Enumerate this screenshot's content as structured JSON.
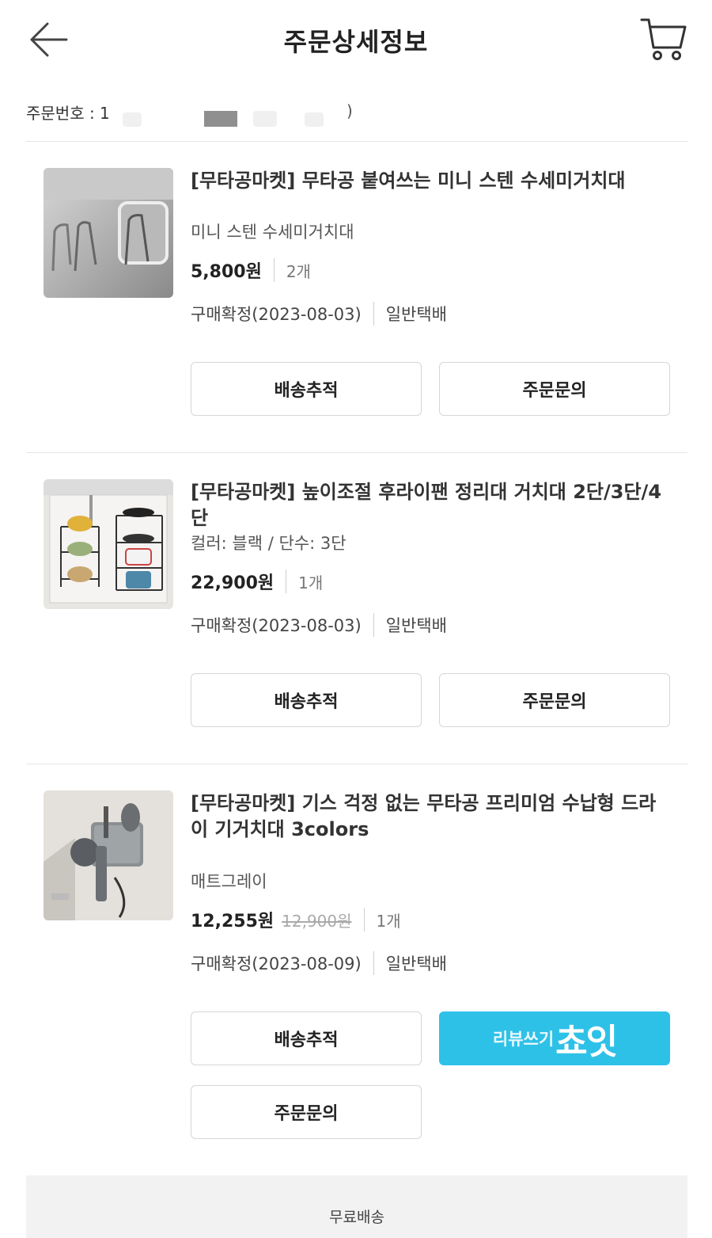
{
  "header": {
    "title": "주문상세정보",
    "back_icon": "arrow-left-icon",
    "cart_icon": "cart-icon"
  },
  "order": {
    "number_label": "주문번호 : 1",
    "trailing": ")"
  },
  "products": [
    {
      "title": "[무타공마켓] 무타공 붙여쓰는 미니 스텐 수세미거치대",
      "option": "미니 스텐 수세미거치대",
      "price": "5,800원",
      "quantity": "2개",
      "status": "구매확정(2023-08-03)",
      "delivery": "일반택배",
      "buttons": {
        "track": "배송추적",
        "inquiry": "주문문의"
      }
    },
    {
      "title": "[무타공마켓] 높이조절 후라이팬 정리대 거치대 2단/3단/4단",
      "option": "컬러: 블랙 / 단수: 3단",
      "price": "22,900원",
      "quantity": "1개",
      "status": "구매확정(2023-08-03)",
      "delivery": "일반택배",
      "buttons": {
        "track": "배송추적",
        "inquiry": "주문문의"
      }
    },
    {
      "title": "[무타공마켓] 기스 걱정 없는 무타공 프리미엄 수납형 드라이 기거치대 3colors",
      "option": "매트그레이",
      "price": "12,255원",
      "original_price": "12,900원",
      "quantity": "1개",
      "status": "구매확정(2023-08-09)",
      "delivery": "일반택배",
      "buttons": {
        "track": "배송추적",
        "review": "리뷰쓰기",
        "review_logo": "쵸잇",
        "inquiry": "주문문의"
      }
    }
  ],
  "footer": {
    "shipping": "무료배송"
  },
  "colors": {
    "review_button": "#2ec1e8",
    "divider": "#e4e4e4",
    "footer_bg": "#f2f2f2"
  }
}
